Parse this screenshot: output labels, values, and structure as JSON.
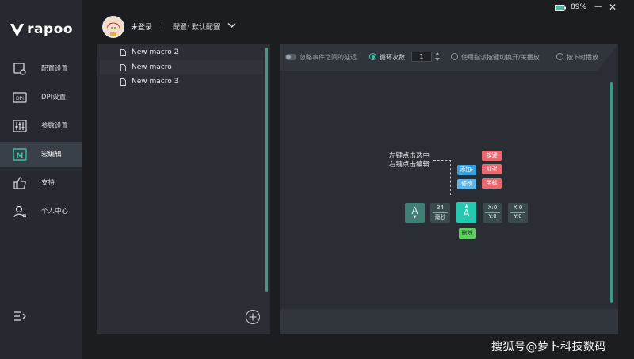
{
  "brand": {
    "logo_text": "rapoo"
  },
  "header": {
    "user_name": "未登录",
    "profile_label": "配置: 默认配置",
    "battery_percent": "89%",
    "minimize_label": "—",
    "close_label": "✕"
  },
  "sidebar": {
    "items": [
      {
        "label": "配置设置",
        "icon": "config-icon",
        "active": false
      },
      {
        "label": "DPI设置",
        "icon": "dpi-icon",
        "active": false
      },
      {
        "label": "参数设置",
        "icon": "sliders-icon",
        "active": false
      },
      {
        "label": "宏编辑",
        "icon": "macro-icon",
        "active": true
      },
      {
        "label": "支持",
        "icon": "thumbs-up-icon",
        "active": false
      },
      {
        "label": "个人中心",
        "icon": "user-icon",
        "active": false
      }
    ]
  },
  "macro_list": {
    "items": [
      {
        "label": "New macro 2"
      },
      {
        "label": "New macro"
      },
      {
        "label": "New macro 3"
      }
    ]
  },
  "toolbar": {
    "ignore_delay_label": "忽略事件之间的延迟",
    "loop_label": "循环次数",
    "loop_count": "1",
    "toggle_label": "使用指派按键切换开/关播放",
    "hold_label": "按下时播放"
  },
  "editor": {
    "hint_line1": "左键点击选中",
    "hint_line2": "右键点击编辑",
    "add_label": "添加",
    "edit_label": "修改",
    "menu_key": "按键",
    "menu_delay": "延迟",
    "menu_coord": "坐标",
    "delete_label": "删除",
    "tiles": {
      "key_down": "A",
      "delay_value": "34",
      "delay_unit": "毫秒",
      "key_up": "A",
      "coord1_x": "X:0",
      "coord1_y": "Y:0",
      "coord2_x": "X:0",
      "coord2_y": "Y:0"
    }
  },
  "watermark": "搜狐号@萝卜科技数码",
  "colors": {
    "accent": "#36c3a3",
    "sidebar_bg": "#262a30",
    "panel_bg": "#2b2f35"
  }
}
